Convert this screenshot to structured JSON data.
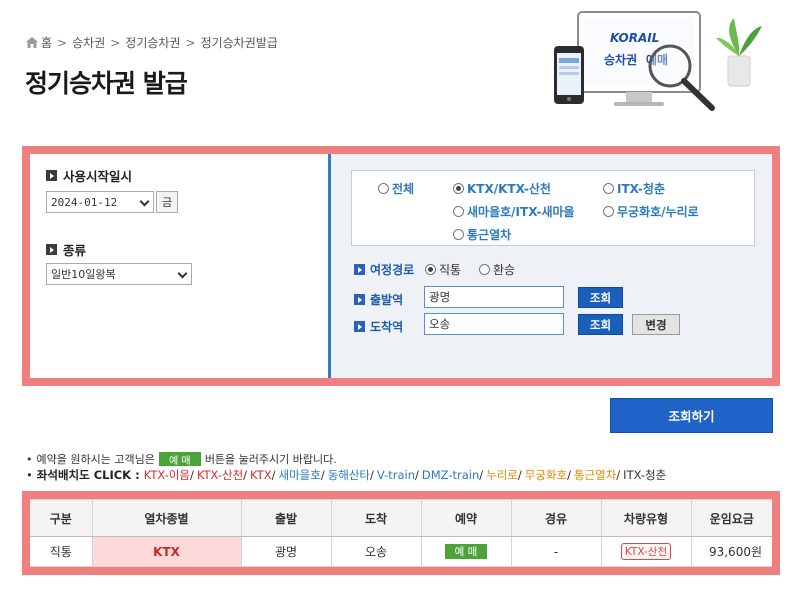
{
  "breadcrumb": {
    "items": [
      "홈",
      "승차권",
      "정기승차권",
      "정기승차권발급"
    ],
    "separator": ">"
  },
  "page_title": "정기승차권 발급",
  "banner": {
    "logo": "KORAIL",
    "caption_a": "승차권",
    "caption_b": "예매"
  },
  "left_pane": {
    "start_date_label": "사용시작일시",
    "start_date_value": "2024-01-12",
    "day_of_week": "금",
    "kind_label": "종류",
    "kind_value": "일반10일왕복"
  },
  "train_types": [
    {
      "label": "전체",
      "checked": false
    },
    {
      "label": "KTX/KTX-산천",
      "checked": true
    },
    {
      "label": "ITX-청춘",
      "checked": false
    },
    {
      "label": "새마을호/ITX-새마을",
      "checked": false
    },
    {
      "label": "무궁화호/누리로",
      "checked": false
    },
    {
      "label": "통근열차",
      "checked": false
    }
  ],
  "route": {
    "label": "여정경로",
    "options": [
      {
        "label": "직통",
        "checked": true
      },
      {
        "label": "환승",
        "checked": false
      }
    ]
  },
  "departure": {
    "label": "출발역",
    "value": "광명",
    "lookup_label": "조회"
  },
  "arrival": {
    "label": "도착역",
    "value": "오송",
    "lookup_label": "조회",
    "swap_label": "변경"
  },
  "search_button": "조회하기",
  "notice": {
    "prefix": "예약을 원하시는 고객님은",
    "chip": "예 매",
    "suffix": "버튼을 눌러주시기 바랍니다."
  },
  "seatmap": {
    "label": "좌석배치도 CLICK :",
    "links": [
      {
        "text": "KTX-이음",
        "color": "#d32f2f"
      },
      {
        "text": "KTX-산천",
        "color": "#d32f2f"
      },
      {
        "text": "KTX",
        "color": "#d32f2f"
      },
      {
        "text": "새마을호",
        "color": "#2a7ac0"
      },
      {
        "text": "동해산타",
        "color": "#2a7ac0"
      },
      {
        "text": "V-train",
        "color": "#2a7ac0"
      },
      {
        "text": "DMZ-train",
        "color": "#2a7ac0"
      },
      {
        "text": "누리로",
        "color": "#e08a00"
      },
      {
        "text": "무궁화호",
        "color": "#e08a00"
      },
      {
        "text": "통근열차",
        "color": "#e08a00"
      },
      {
        "text": "ITX-청춘",
        "color": "#333333"
      }
    ]
  },
  "results": {
    "headers": [
      "구분",
      "열차종별",
      "출발",
      "도착",
      "예약",
      "경유",
      "차량유형",
      "운임요금"
    ],
    "rows": [
      {
        "kind": "직통",
        "train": "KTX",
        "from": "광명",
        "to": "오송",
        "reserve": "예 매",
        "via": "-",
        "car_type": "KTX-산천",
        "fare": "93,600원"
      }
    ]
  },
  "colors": {
    "highlight_border": "#f07f7f",
    "primary_blue": "#1f62c8",
    "reserve_green": "#4ca33a"
  }
}
